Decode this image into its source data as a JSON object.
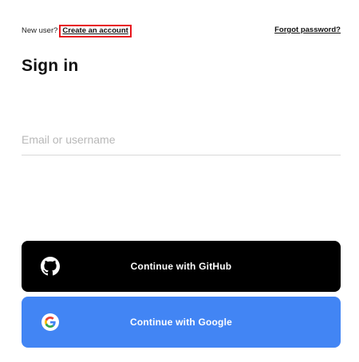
{
  "header": {
    "new_user_text": "New user?",
    "create_account_label": "Create an account",
    "forgot_password_label": "Forgot password?"
  },
  "title": "Sign in",
  "email": {
    "placeholder": "Email or username",
    "value": ""
  },
  "buttons": {
    "github": {
      "label": "Continue with GitHub",
      "icon": "github-icon",
      "color": "#000000"
    },
    "google": {
      "label": "Continue with Google",
      "icon": "google-icon",
      "color": "#4285F4"
    }
  },
  "colors": {
    "highlight_border": "#E8141C",
    "text": "#111111"
  }
}
